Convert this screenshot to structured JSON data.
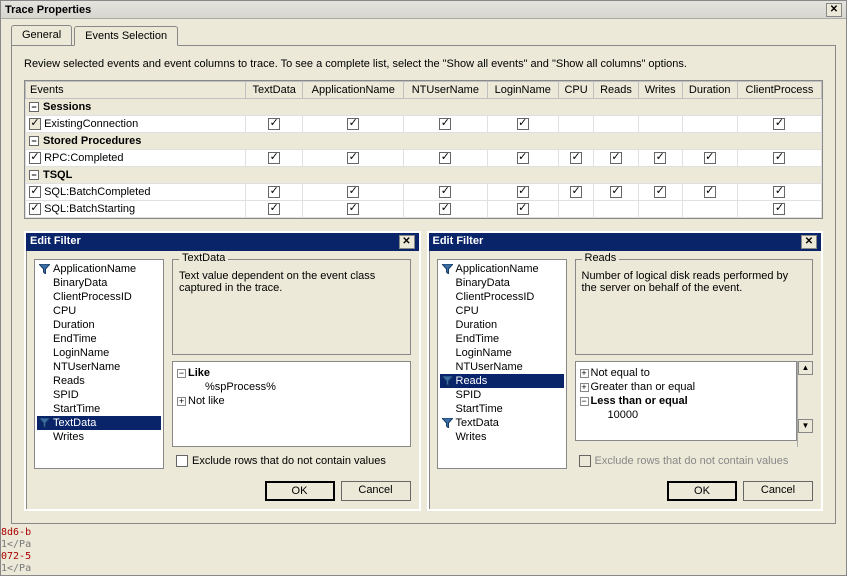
{
  "title": "Trace Properties",
  "tabs": {
    "general": "General",
    "events": "Events Selection"
  },
  "description": "Review selected events and event columns to trace. To see a complete list, select the \"Show all events\" and \"Show all columns\" options.",
  "columns": [
    "Events",
    "TextData",
    "ApplicationName",
    "NTUserName",
    "LoginName",
    "CPU",
    "Reads",
    "Writes",
    "Duration",
    "ClientProcess"
  ],
  "groups": {
    "sessions": "Sessions",
    "stored": "Stored Procedures",
    "tsql": "TSQL"
  },
  "rows": {
    "existing": "ExistingConnection",
    "rpc": "RPC:Completed",
    "batchcomp": "SQL:BatchCompleted",
    "batchstart": "SQL:BatchStarting"
  },
  "filter": {
    "title": "Edit Filter",
    "fields": [
      "ApplicationName",
      "BinaryData",
      "ClientProcessID",
      "CPU",
      "Duration",
      "EndTime",
      "LoginName",
      "NTUserName",
      "Reads",
      "SPID",
      "StartTime",
      "TextData",
      "Writes"
    ],
    "leftSelected": "TextData",
    "rightSelected": "Reads",
    "textdata": {
      "legend": "TextData",
      "desc": "Text value dependent on the event class captured in the trace.",
      "like": "Like",
      "likeval": "%spProcess%",
      "notlike": "Not like"
    },
    "reads": {
      "legend": "Reads",
      "desc": "Number of logical disk reads performed by the server on behalf of the event.",
      "neq": "Not equal to",
      "gte": "Greater than or equal",
      "lte": "Less than or equal",
      "lteval": "10000"
    },
    "exclude": "Exclude rows that do not contain values",
    "ok": "OK",
    "cancel": "Cancel"
  },
  "strip": {
    "a": "8d6-b",
    "b": "1</Pa",
    "c": "072-5",
    "d": "1</Pa"
  }
}
